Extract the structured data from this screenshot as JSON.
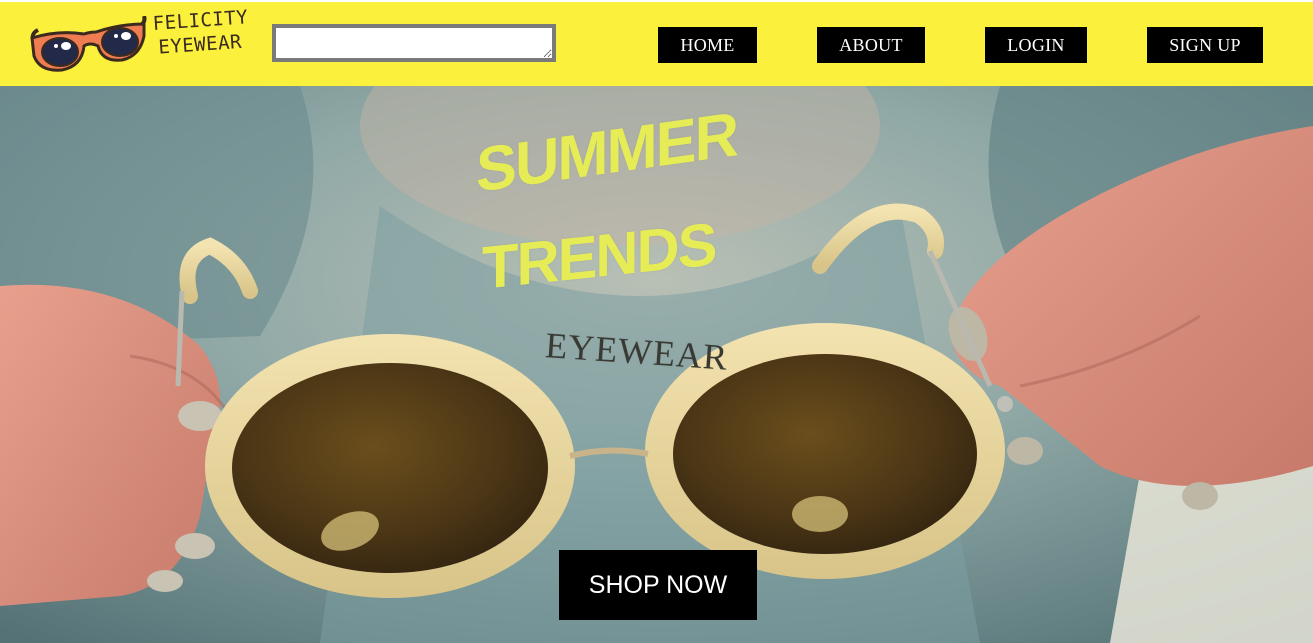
{
  "brand": {
    "name_line1": "FELICITY",
    "name_line2": "EYEWEAR",
    "logo_icon": "sunglasses-logo-icon"
  },
  "search": {
    "value": "",
    "placeholder": ""
  },
  "nav": {
    "home": "HOME",
    "about": "ABOUT",
    "login": "LOGIN",
    "signup": "SIGN UP"
  },
  "hero": {
    "title_line1": "SUMMER",
    "title_line2": "TRENDS",
    "title_line3": "EYEWEAR",
    "cta": "SHOP NOW",
    "image": "woman-holding-round-sunglasses"
  },
  "colors": {
    "header_bg": "#fbf03b",
    "nav_button_bg": "#000000",
    "nav_button_text": "#ffffff",
    "title_yellow": "#e6ec56",
    "title_dark": "#3a3a34"
  }
}
